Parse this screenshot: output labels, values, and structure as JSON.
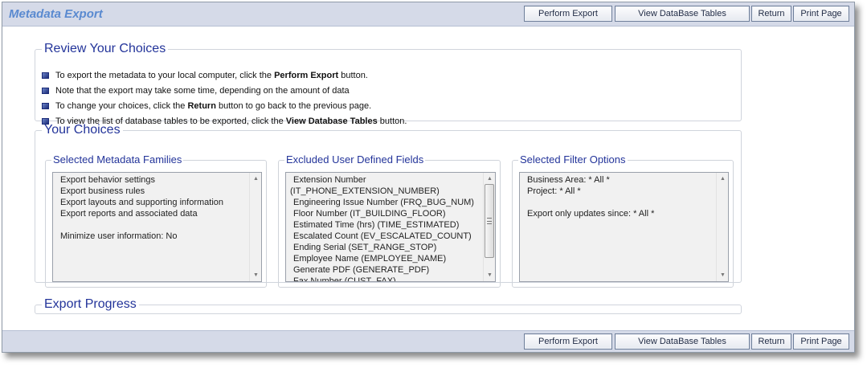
{
  "app": {
    "title": "Metadata Export"
  },
  "toolbar": {
    "perform_export": "Perform Export",
    "view_tables": "View DataBase Tables",
    "return": "Return",
    "print_page": "Print Page"
  },
  "review": {
    "heading": "Review Your Choices",
    "items": [
      {
        "pre": "To export the metadata to your local computer, click the ",
        "bold": "Perform Export",
        "post": " button."
      },
      {
        "pre": "Note that the export may take some time, depending on the amount of data",
        "bold": "",
        "post": ""
      },
      {
        "pre": "To change your choices, click the ",
        "bold": "Return",
        "post": " button to go back to the previous page."
      },
      {
        "pre": "To view the list of database tables to be exported, click the ",
        "bold": "View Database Tables",
        "post": " button."
      }
    ]
  },
  "choices": {
    "heading": "Your Choices",
    "families": {
      "heading": "Selected Metadata Families",
      "lines": [
        "Export behavior settings",
        "Export business rules",
        "Export layouts and supporting information",
        "Export reports and associated data",
        "",
        "Minimize user information: No"
      ]
    },
    "excluded": {
      "heading": "Excluded User Defined Fields",
      "lines": [
        "Extension Number",
        "(IT_PHONE_EXTENSION_NUMBER)",
        "Engineering Issue Number (FRQ_BUG_NUM)",
        "Floor Number (IT_BUILDING_FLOOR)",
        "Estimated Time (hrs) (TIME_ESTIMATED)",
        "Escalated Count (EV_ESCALATED_COUNT)",
        "Ending Serial (SET_RANGE_STOP)",
        "Employee Name (EMPLOYEE_NAME)",
        "Generate PDF (GENERATE_PDF)",
        "Fax Number (CUST_FAX)"
      ]
    },
    "filters": {
      "heading": "Selected Filter Options",
      "lines": [
        "Business Area: * All *",
        "Project: * All *",
        "",
        "Export only updates since: * All *"
      ]
    }
  },
  "progress": {
    "heading": "Export Progress"
  }
}
